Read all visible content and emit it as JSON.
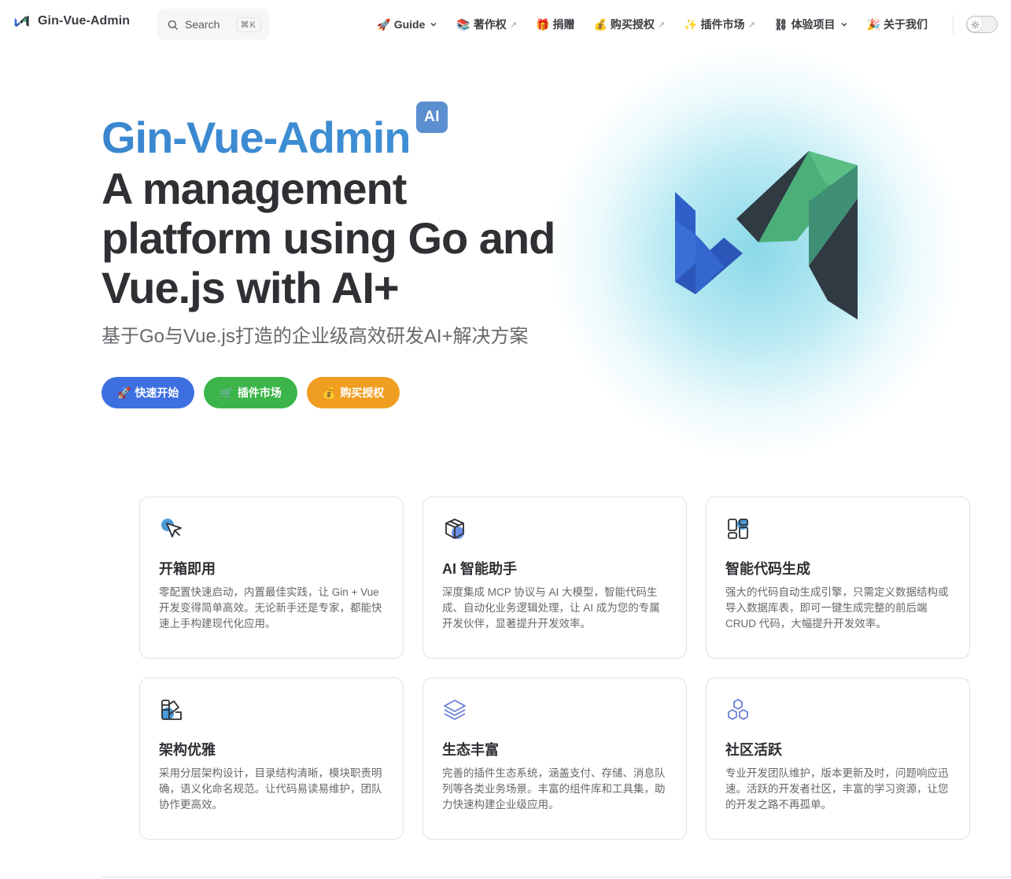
{
  "nav": {
    "brand_title": "Gin-Vue-Admin",
    "search": {
      "label": "Search",
      "shortcut": "⌘K"
    },
    "menu": [
      {
        "emoji": "🚀",
        "label": "Guide",
        "chevron": true
      },
      {
        "emoji": "📚",
        "label": "著作权",
        "external": "↗"
      },
      {
        "emoji": "🎁",
        "label": "捐赠"
      },
      {
        "emoji": "💰",
        "label": "购买授权",
        "external": "↗"
      },
      {
        "emoji": "✨",
        "label": "插件市场",
        "external": "↗"
      },
      {
        "emoji": "⛓",
        "label": "体验项目",
        "chevron": true
      },
      {
        "emoji": "🎉",
        "label": "关于我们"
      }
    ],
    "theme_icon": "sun-icon"
  },
  "hero": {
    "name": "Gin-Vue-Admin",
    "badge": "AI",
    "text": "A management platform using Go and Vue.js with AI+",
    "tagline": "基于Go与Vue.js打造的企业级高效研发AI+解决方案",
    "actions": [
      {
        "emoji": "🚀",
        "label": "快速开始"
      },
      {
        "emoji": "🛒",
        "label": "插件市场"
      },
      {
        "emoji": "💰",
        "label": "购买授权"
      }
    ]
  },
  "features": [
    {
      "icon": "cursor-click-icon",
      "title": "开箱即用",
      "desc": "零配置快速启动，内置最佳实践，让 Gin + Vue 开发变得简单高效。无论新手还是专家，都能快速上手构建现代化应用。"
    },
    {
      "icon": "cube-icon",
      "title": "AI 智能助手",
      "desc": "深度集成 MCP 协议与 AI 大模型，智能代码生成、自动化业务逻辑处理，让 AI 成为您的专属开发伙伴，显著提升开发效率。"
    },
    {
      "icon": "layout-grid-icon",
      "title": "智能代码生成",
      "desc": "强大的代码自动生成引擎，只需定义数据结构或导入数据库表，即可一键生成完整的前后端 CRUD 代码，大幅提升开发效率。"
    },
    {
      "icon": "swatch-book-icon",
      "title": "架构优雅",
      "desc": "采用分层架构设计，目录结构清晰，模块职责明确，语义化命名规范。让代码易读易维护，团队协作更高效。"
    },
    {
      "icon": "layers-icon",
      "title": "生态丰富",
      "desc": "完善的插件生态系统，涵盖支付、存储、消息队列等各类业务场景。丰富的组件库和工具集，助力快速构建企业级应用。"
    },
    {
      "icon": "hexagons-icon",
      "title": "社区活跃",
      "desc": "专业开发团队维护，版本更新及时，问题响应迅速。活跃的开发者社区，丰富的学习资源，让您的开发之路不再孤单。"
    }
  ],
  "colors": {
    "brand_blue": "#3a87cf",
    "btn_blue": "#3d6fe0",
    "btn_green": "#3bb54a",
    "btn_orange": "#ef9e22",
    "badge": "#5b8fd0"
  }
}
